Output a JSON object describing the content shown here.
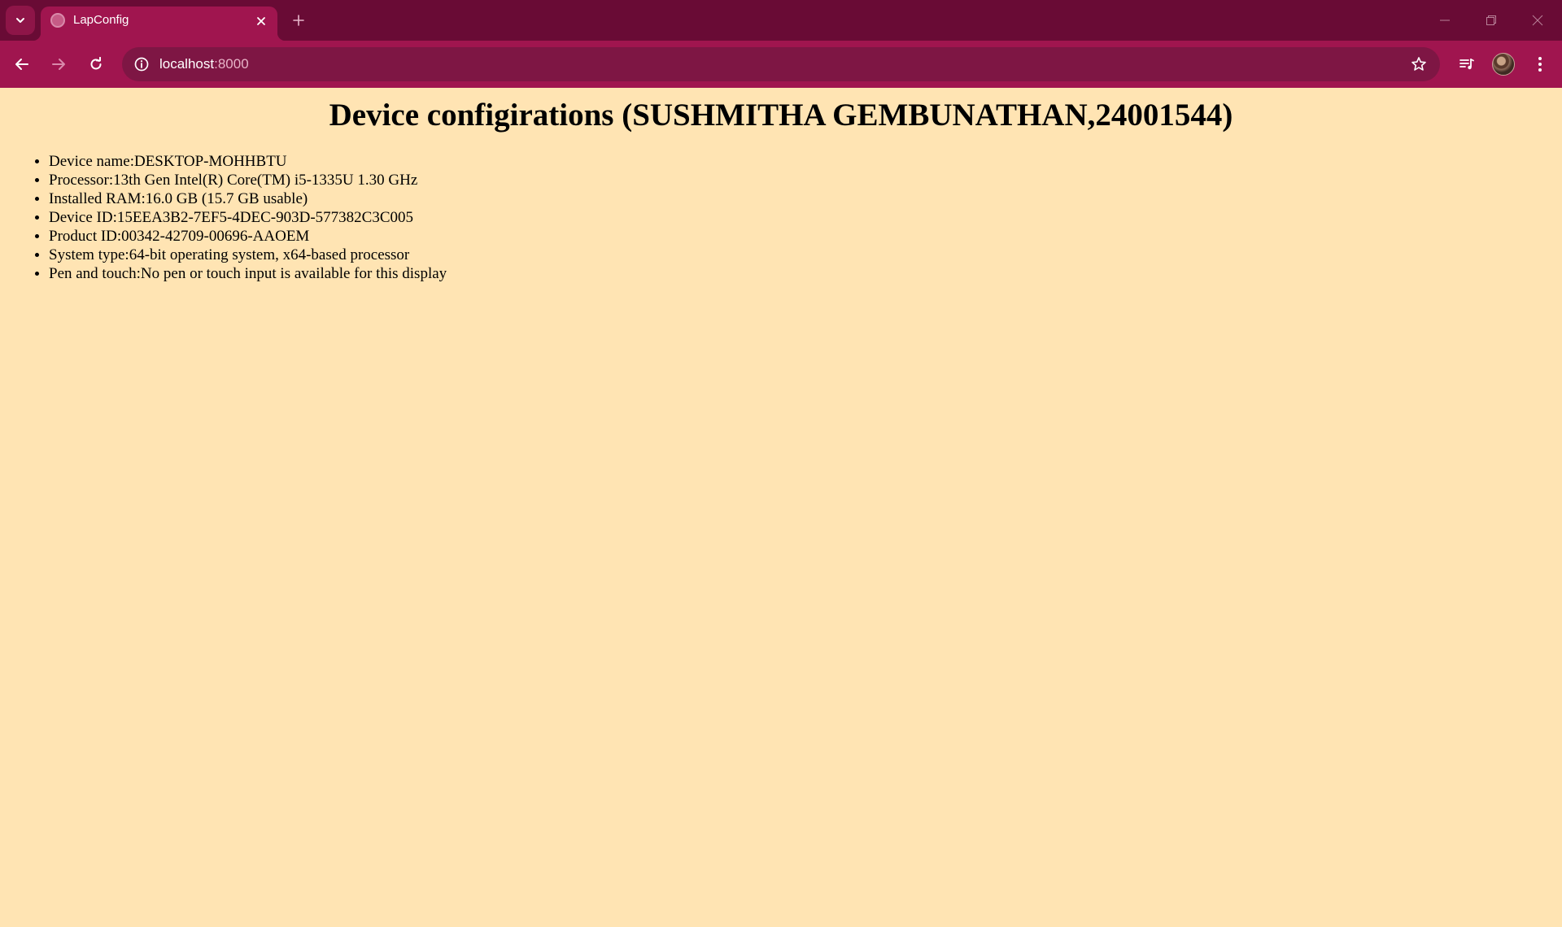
{
  "browser": {
    "tab": {
      "title": "LapConfig"
    },
    "address_bar": {
      "host": "localhost",
      "port": ":8000"
    }
  },
  "page": {
    "heading": "Device configirations (SUSHMITHA GEMBUNATHAN,24001544)",
    "specs": [
      "Device name:DESKTOP-MOHHBTU",
      "Processor:13th Gen Intel(R) Core(TM) i5-1335U 1.30 GHz",
      "Installed RAM:16.0 GB (15.7 GB usable)",
      "Device ID:15EEA3B2-7EF5-4DEC-903D-577382C3C005",
      "Product ID:00342-42709-00696-AAOEM",
      "System type:64-bit operating system, x64-based processor",
      "Pen and touch:No pen or touch input is available for this display"
    ]
  },
  "colors": {
    "tabstrip": "#690b35",
    "toolbar": "#a0154f",
    "omnibox": "#7e1644",
    "page_background": "#ffe4b3"
  },
  "icons": [
    "tab-search-icon",
    "favicon-icon",
    "close-icon",
    "plus-icon",
    "minimize-icon",
    "restore-icon",
    "window-close-icon",
    "back-arrow-icon",
    "forward-arrow-icon",
    "reload-icon",
    "info-icon",
    "star-icon",
    "media-controls-icon",
    "avatar",
    "kebab-menu-icon"
  ]
}
